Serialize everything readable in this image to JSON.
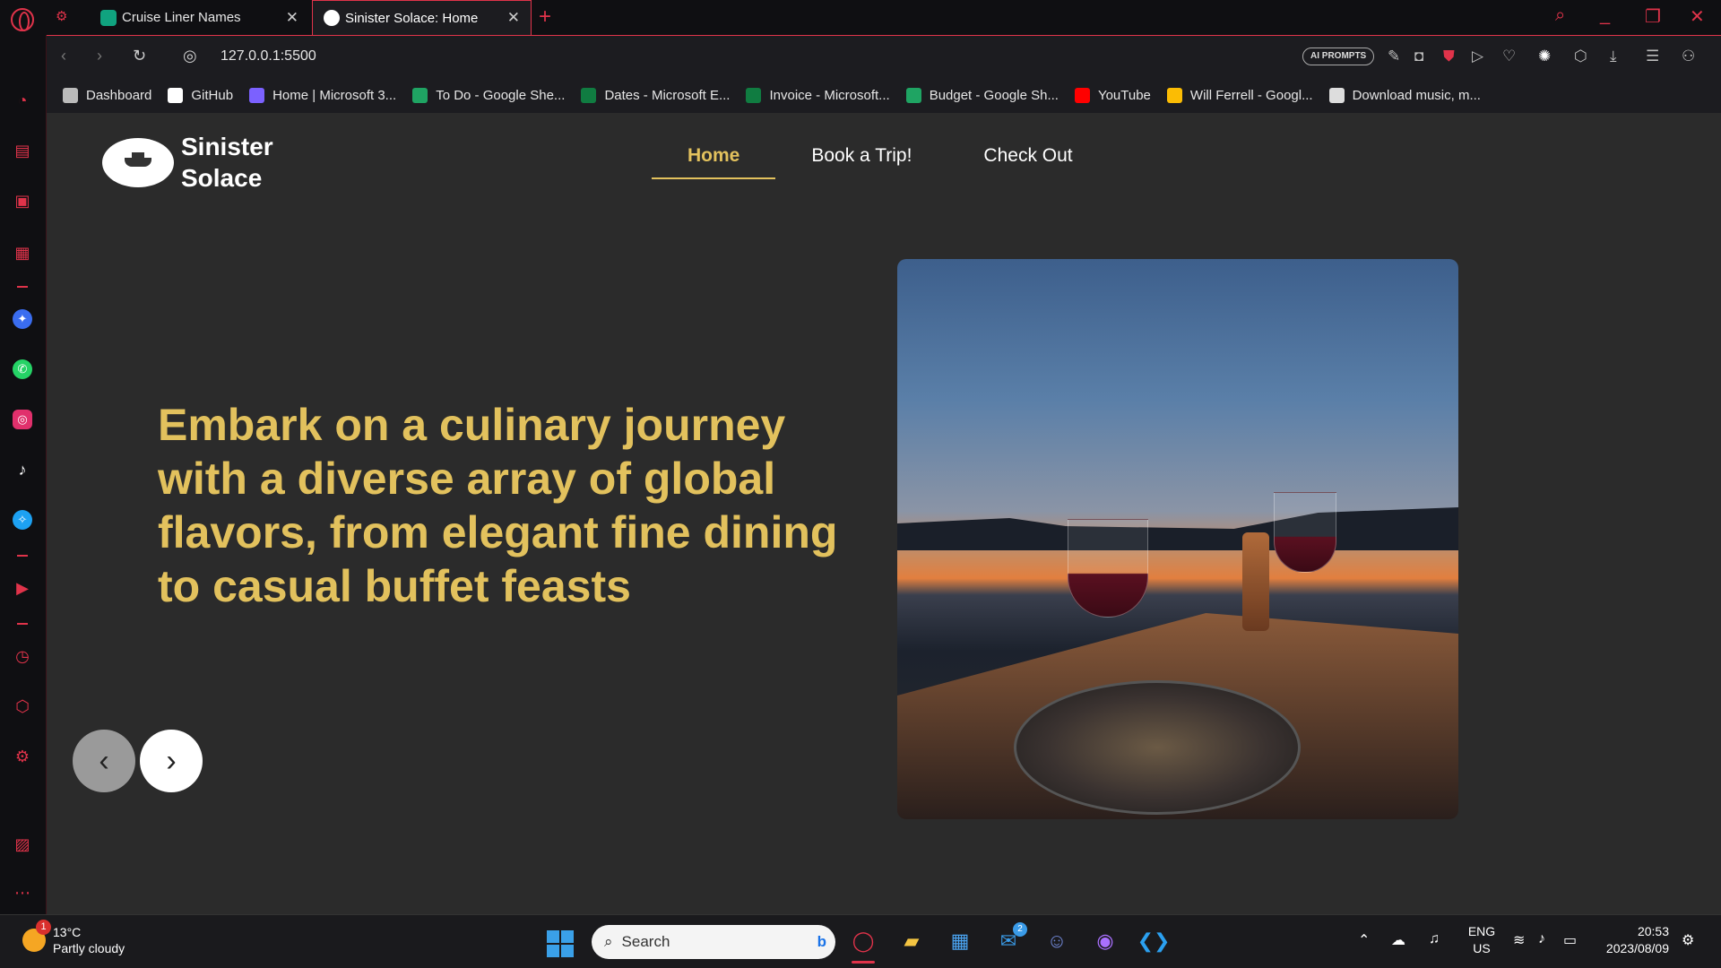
{
  "browser": {
    "tabs": [
      {
        "label": "Cruise Liner Names",
        "active": false,
        "favicon_color": "#10a37f"
      },
      {
        "label": "Sinister Solace: Home",
        "active": true,
        "favicon_color": "#ffffff"
      }
    ],
    "url": "127.0.0.1:5500",
    "ai_prompts_label": "AI PROMPTS",
    "accent_color": "#e0334a"
  },
  "bookmarks": [
    {
      "label": "Dashboard",
      "icon": "dashboard-icon",
      "color": "#bbbbbb"
    },
    {
      "label": "GitHub",
      "icon": "github-icon",
      "color": "#ffffff"
    },
    {
      "label": "Home | Microsoft 3...",
      "icon": "microsoft365-icon",
      "color": "#7b61ff"
    },
    {
      "label": "To Do - Google She...",
      "icon": "google-sheets-icon",
      "color": "#1fa463"
    },
    {
      "label": "Dates - Microsoft E...",
      "icon": "excel-icon",
      "color": "#107c41"
    },
    {
      "label": "Invoice - Microsoft...",
      "icon": "excel-icon",
      "color": "#107c41"
    },
    {
      "label": "Budget - Google Sh...",
      "icon": "google-sheets-icon",
      "color": "#1fa463"
    },
    {
      "label": "YouTube",
      "icon": "youtube-icon",
      "color": "#ff0000"
    },
    {
      "label": "Will Ferrell - Googl...",
      "icon": "google-drive-icon",
      "color": "#fbbc04"
    },
    {
      "label": "Download music, m...",
      "icon": "music-download-icon",
      "color": "#dddddd"
    }
  ],
  "site": {
    "brand": "Sinister Solace",
    "nav": [
      {
        "label": "Home",
        "active": true
      },
      {
        "label": "Book a Trip!",
        "active": false
      },
      {
        "label": "Check Out",
        "active": false
      }
    ],
    "headline": "Embark on a culinary journey with a diverse array of global flavors, from elegant fine dining to casual buffet feasts",
    "accent_color": "#e2c15d",
    "carousel": {
      "prev_icon": "chevron-left-icon",
      "next_icon": "chevron-right-icon"
    }
  },
  "taskbar": {
    "weather_temp": "13°C",
    "weather_desc": "Partly cloudy",
    "weather_badge": "1",
    "search_placeholder": "Search",
    "mail_badge": "2",
    "language_top": "ENG",
    "language_bottom": "US",
    "time": "20:53",
    "date": "2023/08/09"
  }
}
